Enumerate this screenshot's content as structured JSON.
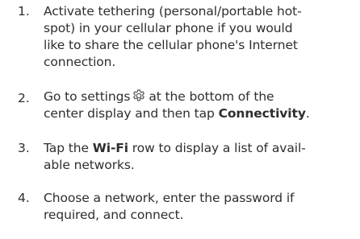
{
  "steps": [
    {
      "number": "1.",
      "lines": [
        "Activate tethering (personal/portable hot-",
        "spot) in your cellular phone if you would",
        "like to share the cellular phone's Internet",
        "connection."
      ]
    },
    {
      "number": "2.",
      "line1_before_icon": "Go to settings",
      "line1_after_icon": "at the bottom of the",
      "line2_before": "center display and then tap ",
      "line2_term": "Connectivity",
      "line2_after": ".",
      "icon": "gear-icon"
    },
    {
      "number": "3.",
      "line1_before": "Tap the ",
      "line1_term": "Wi-Fi",
      "line1_after": " row to display a list of avail-",
      "line2": "able networks."
    },
    {
      "number": "4.",
      "lines": [
        "Choose a network, enter the password if",
        "required, and connect."
      ]
    }
  ]
}
